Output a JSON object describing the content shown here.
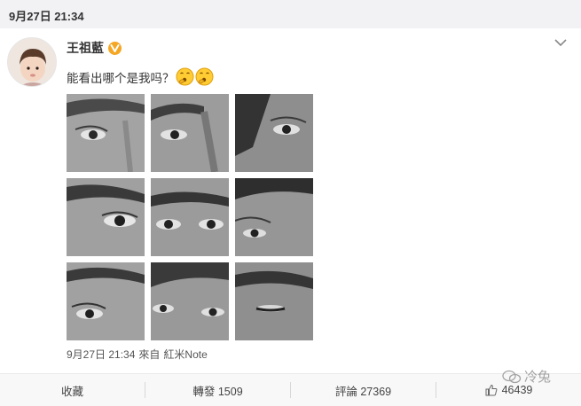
{
  "header": {
    "date": "9月27日 21:34"
  },
  "post": {
    "author": "王祖藍",
    "verified_color": "#f5a623",
    "text": "能看出哪个是我吗？",
    "emoji": [
      "thinking-emoji",
      "thinking-emoji"
    ],
    "photos": 9,
    "meta": {
      "time": "9月27日 21:34",
      "from_label": "來自",
      "source": "紅米Note"
    }
  },
  "actions": {
    "collect": "收藏",
    "repost": "轉發 1509",
    "comment": "評論 27369",
    "like": "46439"
  },
  "watermark": {
    "text": "冷兔"
  }
}
